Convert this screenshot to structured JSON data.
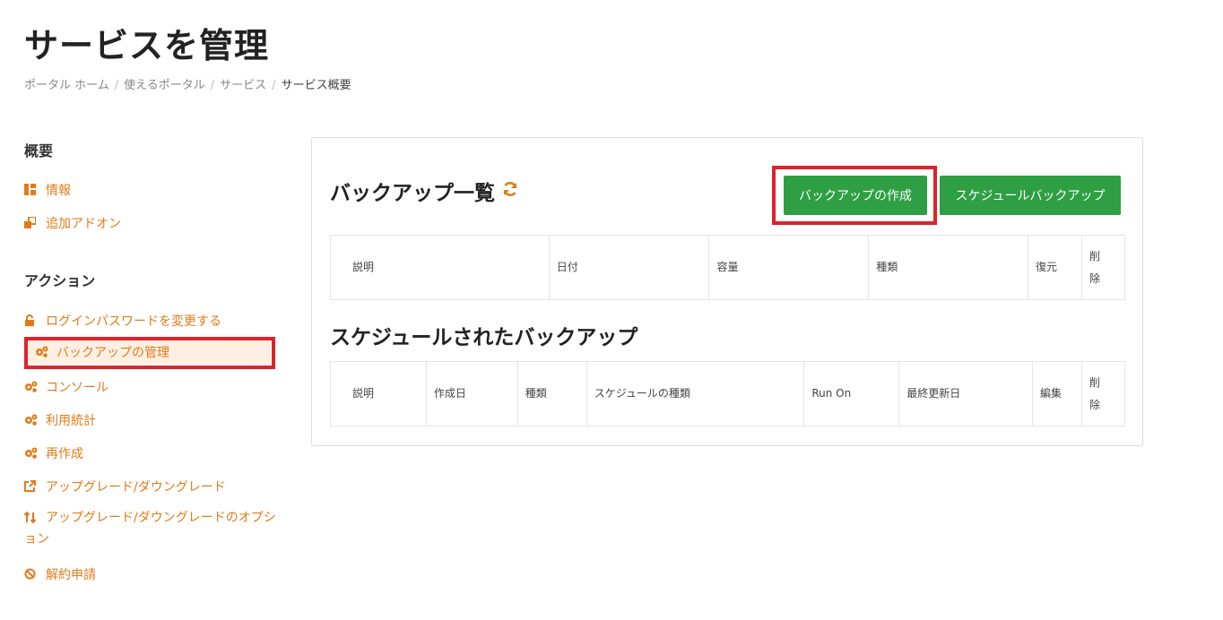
{
  "page": {
    "title": "サービスを管理"
  },
  "breadcrumb": {
    "items": [
      "ポータル ホーム",
      "使えるポータル",
      "サービス"
    ],
    "current": "サービス概要",
    "separator": "/"
  },
  "sidebar": {
    "overview_heading": "概要",
    "overview_items": [
      {
        "label": "情報",
        "icon": "dashboard-icon"
      },
      {
        "label": "追加アドオン",
        "icon": "addon-icon"
      }
    ],
    "actions_heading": "アクション",
    "action_items": [
      {
        "label": "ログインパスワードを変更する",
        "icon": "lock-icon"
      },
      {
        "label": "バックアップの管理",
        "icon": "gears-icon",
        "active": true
      },
      {
        "label": "コンソール",
        "icon": "gears-icon"
      },
      {
        "label": "利用統計",
        "icon": "gears-icon"
      },
      {
        "label": "再作成",
        "icon": "gears-icon"
      },
      {
        "label": "アップグレード/ダウングレード",
        "icon": "external-link-icon"
      },
      {
        "label": "アップグレード/ダウングレードのオプション",
        "icon": "sort-icon"
      },
      {
        "label": "解約申請",
        "icon": "ban-icon"
      }
    ]
  },
  "backups": {
    "title": "バックアップ一覧",
    "create_button": "バックアップの作成",
    "schedule_button": "スケジュールバックアップ",
    "columns": [
      "説明",
      "日付",
      "容量",
      "種類",
      "復元",
      "削除"
    ]
  },
  "scheduled": {
    "title": "スケジュールされたバックアップ",
    "columns": [
      "説明",
      "作成日",
      "種類",
      "スケジュールの種類",
      "Run On",
      "最終更新日",
      "編集",
      "削除"
    ]
  },
  "colors": {
    "accent": "#e07b1a",
    "button": "#2ea043",
    "highlight": "#e0222a",
    "active_bg": "#fdf0e3"
  }
}
